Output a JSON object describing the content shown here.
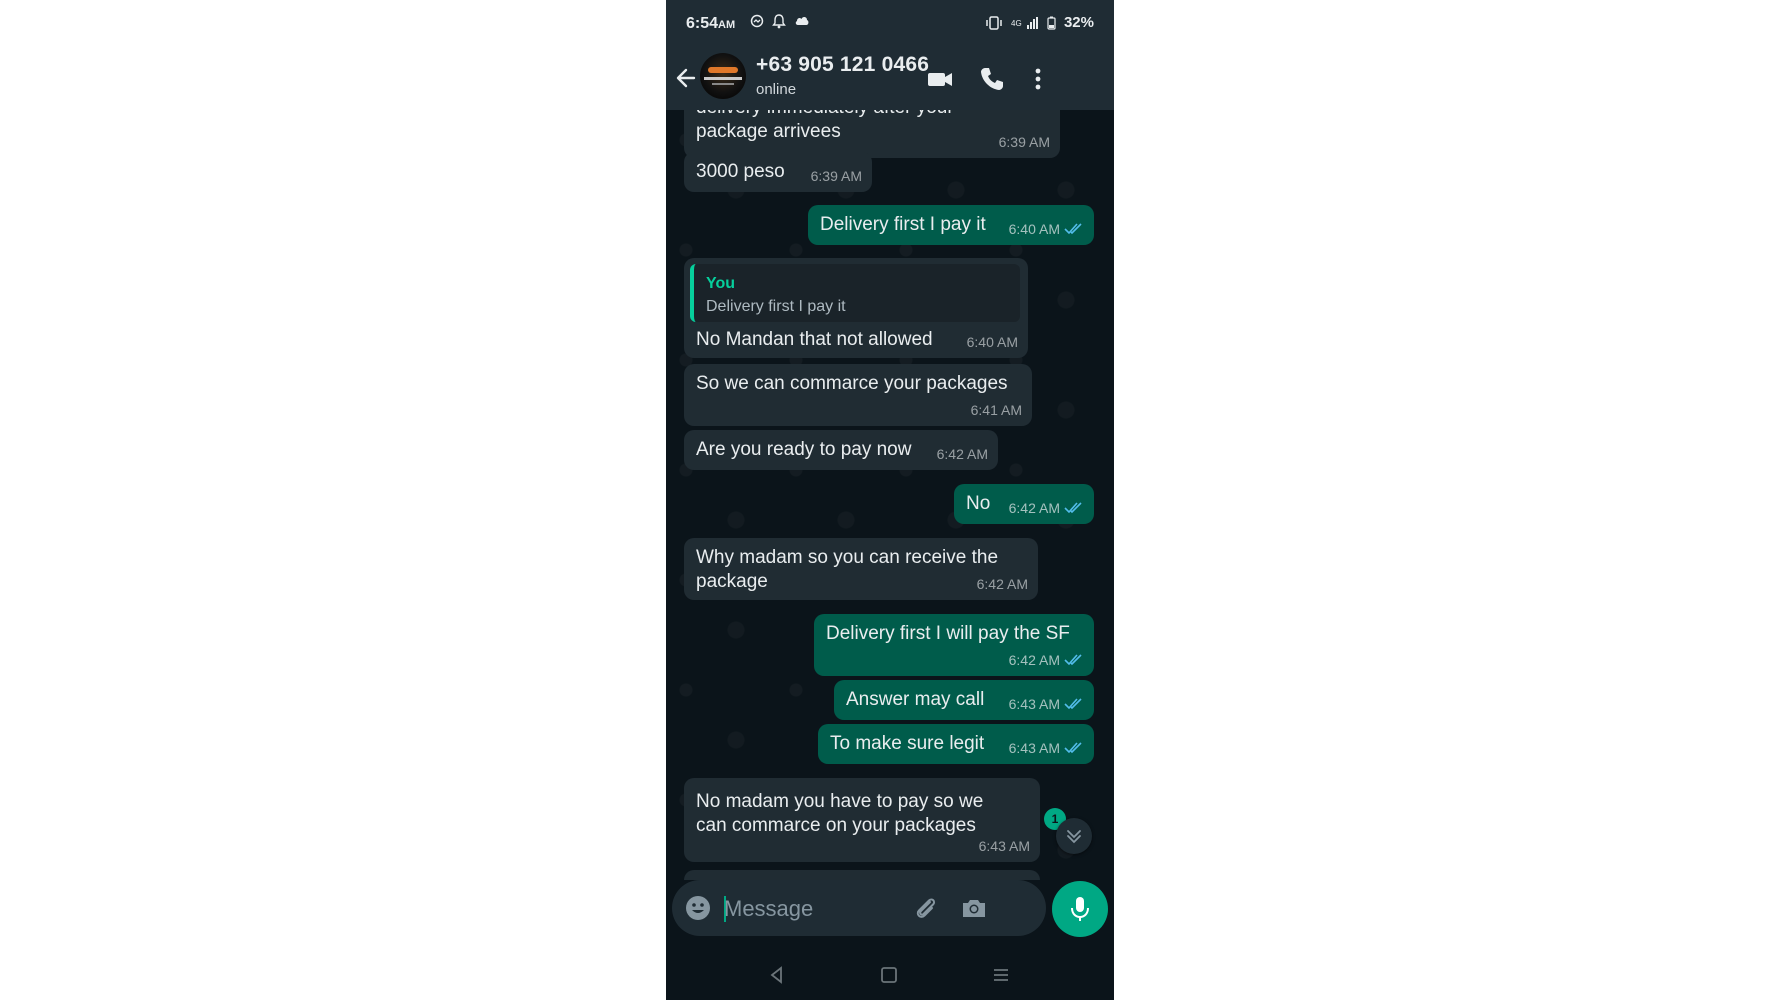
{
  "status_bar": {
    "time": "6:54",
    "ampm": "AM",
    "battery": "32%"
  },
  "header": {
    "contact_name": "+63 905 121 0466",
    "status": "online"
  },
  "messages": [
    {
      "dir": "in",
      "text1": "delivery immediately after your",
      "text2": "package arrivees",
      "time": "6:39 AM"
    },
    {
      "dir": "in",
      "text": "3000 peso",
      "time": "6:39 AM"
    },
    {
      "dir": "out",
      "text": "Delivery first I pay it",
      "time": "6:40 AM"
    },
    {
      "dir": "in",
      "quote_author": "You",
      "quote_text": "Delivery first I pay it",
      "text": "No Mandan that not allowed",
      "time": "6:40 AM"
    },
    {
      "dir": "in",
      "text": "So we can commarce your packages",
      "time": "6:41 AM"
    },
    {
      "dir": "in",
      "text": "Are you ready to pay now",
      "time": "6:42 AM"
    },
    {
      "dir": "out",
      "text": "No",
      "time": "6:42 AM"
    },
    {
      "dir": "in",
      "text1": "Why madam so you can receive the",
      "text2": "package",
      "time": "6:42 AM"
    },
    {
      "dir": "out",
      "text": "Delivery first I will pay the SF",
      "time": "6:42 AM"
    },
    {
      "dir": "out",
      "text": "Answer may call",
      "time": "6:43 AM"
    },
    {
      "dir": "out",
      "text": "To make sure legit",
      "time": "6:43 AM"
    },
    {
      "dir": "in",
      "text1": "No madam you have to pay so we",
      "text2": "can commarce on your packages",
      "time": "6:43 AM"
    }
  ],
  "unread_count": "1",
  "composer": {
    "placeholder": "Message"
  },
  "colors": {
    "accent": "#00a884",
    "incoming_bubble": "#202c33",
    "outgoing_bubble": "#005c4b",
    "background": "#0b141a",
    "read_ticks": "#53bdeb"
  },
  "icons": [
    "back-arrow-icon",
    "video-call-icon",
    "phone-call-icon",
    "more-options-icon",
    "emoji-icon",
    "attach-icon",
    "camera-icon",
    "microphone-icon",
    "scroll-down-icon",
    "nav-back-icon",
    "nav-home-icon",
    "nav-recents-icon"
  ]
}
